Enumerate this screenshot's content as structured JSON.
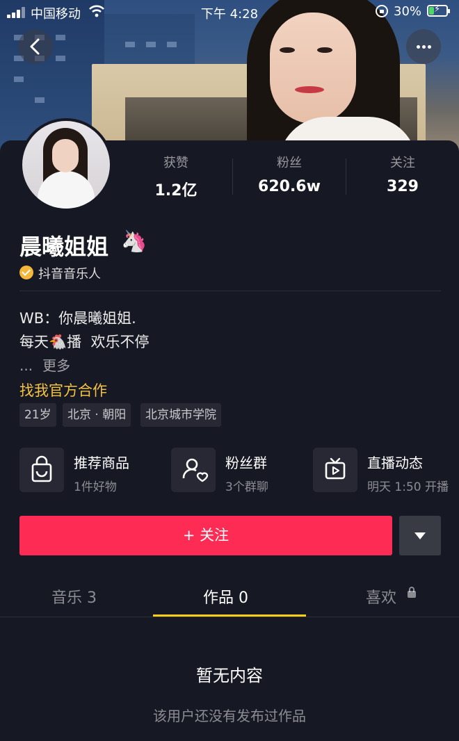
{
  "status_bar": {
    "carrier": "中国移动",
    "time": "下午 4:28",
    "battery_percent": "30%",
    "battery_level": 0.3,
    "icons": [
      "signal-icon",
      "wifi-icon",
      "rotation-lock-icon",
      "battery-charging-icon"
    ]
  },
  "header": {
    "back_icon": "chevron-left-icon",
    "more_icon": "more-dots-icon"
  },
  "stats": [
    {
      "label": "获赞",
      "value": "1.2亿"
    },
    {
      "label": "粉丝",
      "value": "620.6w"
    },
    {
      "label": "关注",
      "value": "329"
    }
  ],
  "profile": {
    "name": "晨曦姐姐",
    "name_emoji": "🦄",
    "verified_label": "抖音音乐人",
    "verified_color": "#f5b73b",
    "bio_line1": "WB：你晨曦姐姐.",
    "bio_line2_prefix": "每天",
    "bio_line2_emoji": "🐔",
    "bio_line2_suffix": "播  欢乐不停",
    "bio_ellipsis": "...",
    "bio_more": "更多",
    "cooperation_link": "找我官方合作",
    "tags": [
      "21岁",
      "北京 · 朝阳",
      "北京城市学院"
    ]
  },
  "features": [
    {
      "title": "推荐商品",
      "sub": "1件好物",
      "icon": "shopping-bag-icon"
    },
    {
      "title": "粉丝群",
      "sub": "3个群聊",
      "icon": "fan-group-icon"
    },
    {
      "title": "直播动态",
      "sub": "明天 1:50 开播",
      "icon": "live-tv-icon"
    }
  ],
  "actions": {
    "follow_label": "+ 关注",
    "follow_color": "#fe2c55",
    "dropdown_icon": "caret-down-icon"
  },
  "tabs": [
    {
      "label": "音乐 3",
      "active": false
    },
    {
      "label": "作品 0",
      "active": true
    },
    {
      "label": "喜欢",
      "active": false,
      "locked": true
    }
  ],
  "accent_color": "#face15",
  "empty_state": {
    "title": "暂无内容",
    "subtitle": "该用户还没有发布过作品"
  }
}
